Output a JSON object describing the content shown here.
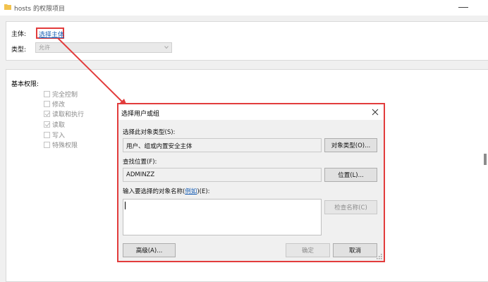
{
  "window": {
    "title": "hosts 的权限项目"
  },
  "principal": {
    "label": "主体:",
    "link_text": "选择主体"
  },
  "type": {
    "label": "类型:",
    "value": "允许"
  },
  "basic_permissions": {
    "title": "基本权限:",
    "items": [
      {
        "label": "完全控制",
        "checked": false
      },
      {
        "label": "修改",
        "checked": false
      },
      {
        "label": "读取和执行",
        "checked": true
      },
      {
        "label": "读取",
        "checked": true
      },
      {
        "label": "写入",
        "checked": false
      },
      {
        "label": "特殊权限",
        "checked": false
      }
    ]
  },
  "dialog": {
    "title": "选择用户或组",
    "object_type_label": "选择此对象类型(S):",
    "object_type_value": "用户、组或内置安全主体",
    "object_types_button": "对象类型(O)...",
    "location_label": "查找位置(F):",
    "location_value": "ADMINZZ",
    "locations_button": "位置(L)...",
    "names_label_prefix": "输入要选择的对象名称(",
    "names_label_link": "例如",
    "names_label_suffix": ")(E):",
    "names_value": "",
    "check_names_button": "检查名称(C)",
    "advanced_button": "高级(A)...",
    "ok_button": "确定",
    "cancel_button": "取消"
  },
  "colors": {
    "highlight": "#e23c3c",
    "link": "#1a5fb4"
  }
}
